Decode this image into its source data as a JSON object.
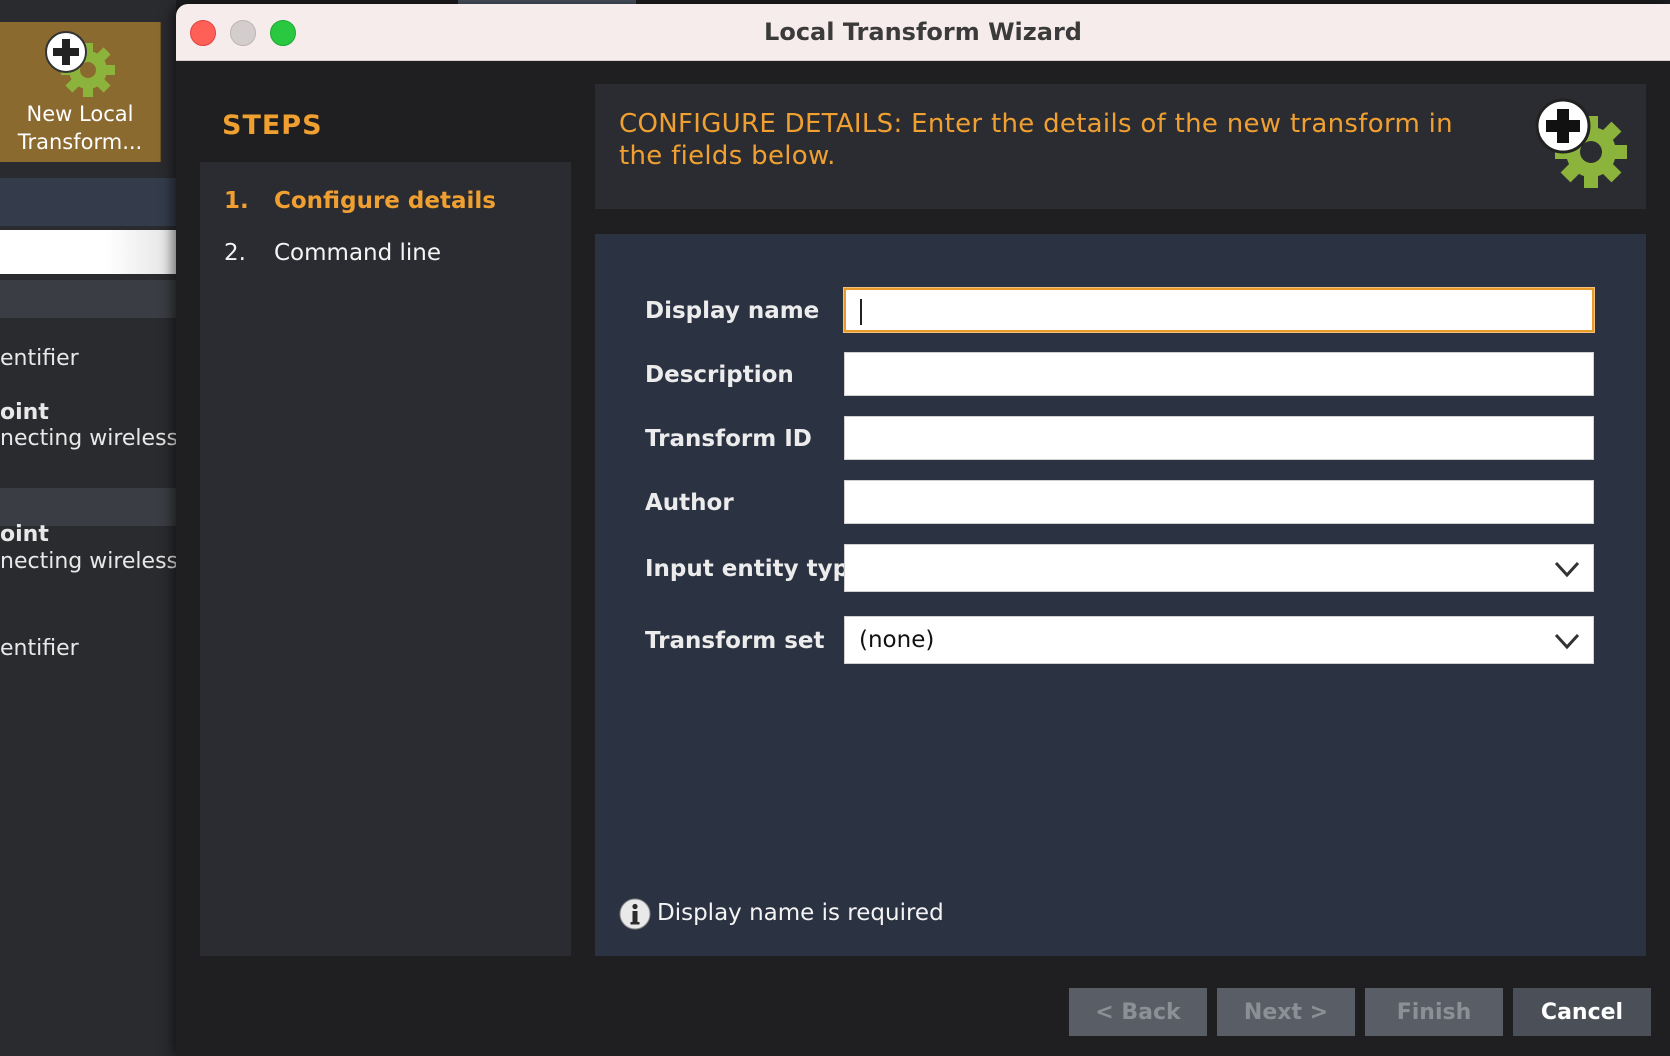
{
  "background_app": {
    "ribbon_button_label_line1": "New Local",
    "ribbon_button_label_line2": "Transform...",
    "list_texts": [
      {
        "text": "entifier",
        "bold": false
      },
      {
        "text": "oint",
        "bold": true
      },
      {
        "text": "necting wireless",
        "bold": false
      },
      {
        "text": "oint",
        "bold": true
      },
      {
        "text": "necting wireless",
        "bold": false
      },
      {
        "text": "entifier",
        "bold": false
      }
    ]
  },
  "window": {
    "title": "Local Transform Wizard"
  },
  "steps": {
    "heading": "STEPS",
    "items": [
      {
        "number": "1.",
        "label": "Configure details",
        "active": true
      },
      {
        "number": "2.",
        "label": "Command line",
        "active": false
      }
    ]
  },
  "header": {
    "text": "CONFIGURE DETAILS: Enter the details of the new transform in the fields below.",
    "icon": "add-gear-icon"
  },
  "form": {
    "fields": [
      {
        "label": "Display name",
        "type": "text",
        "value": "",
        "focused": true
      },
      {
        "label": "Description",
        "type": "text",
        "value": ""
      },
      {
        "label": "Transform ID",
        "type": "text",
        "value": ""
      },
      {
        "label": "Author",
        "type": "text",
        "value": ""
      },
      {
        "label": "Input entity type",
        "type": "select",
        "value": ""
      },
      {
        "label": "Transform set",
        "type": "select",
        "value": "(none)"
      }
    ],
    "message": "Display name is required",
    "message_icon": "info-icon"
  },
  "buttons": {
    "back": "< Back",
    "next": "Next >",
    "finish": "Finish",
    "cancel": "Cancel"
  },
  "colors": {
    "accent": "#f0a030",
    "form_bg": "#2b3242",
    "panel_bg": "#2b2c31",
    "focus_border": "#e89a2a",
    "icon_green": "#8cb43c"
  }
}
